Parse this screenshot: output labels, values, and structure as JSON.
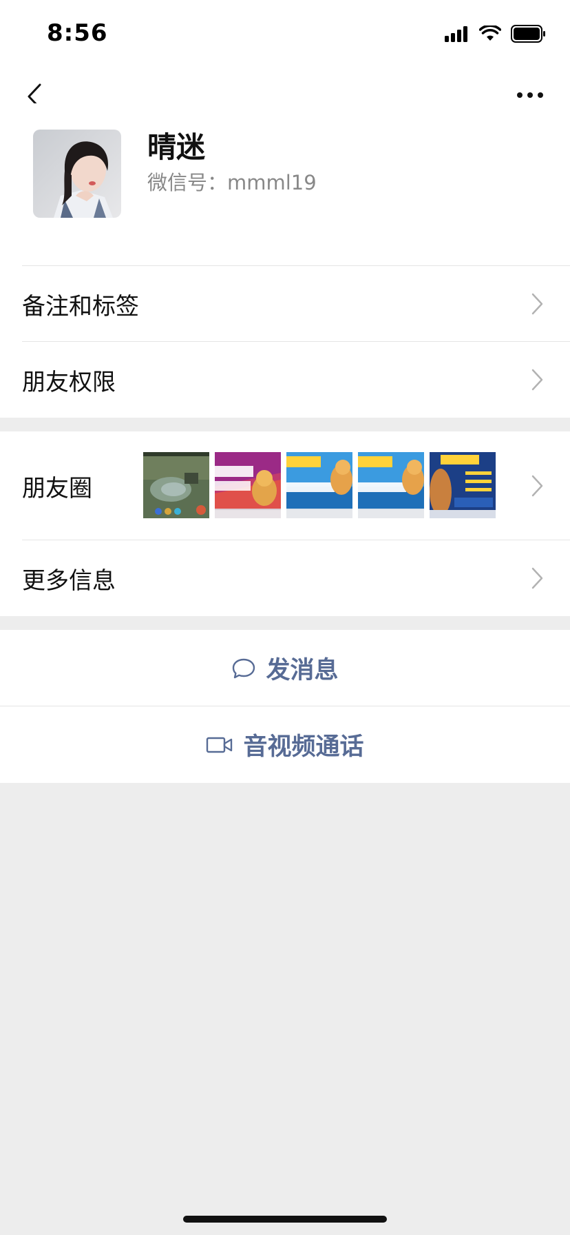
{
  "status_bar": {
    "time": "8:56"
  },
  "profile": {
    "nickname": "晴迷",
    "wechat_id": "微信号：mmml19"
  },
  "menu": {
    "notes_and_tags": "备注和标签",
    "friend_permissions": "朋友权限",
    "moments": "朋友圈",
    "more_info": "更多信息"
  },
  "moments_thumbnails": [
    {
      "name": "game-screenshot",
      "text": ""
    },
    {
      "name": "promo-victory",
      "text": "胜到手 这么优秀"
    },
    {
      "name": "promo-invincible-1",
      "text": "无敌 多么容易"
    },
    {
      "name": "promo-invincible-2",
      "text": "无敌 多么容易"
    },
    {
      "name": "promo-ranking",
      "text": "把把天秀"
    }
  ],
  "actions": {
    "send_message": "发消息",
    "av_call": "音视频通话"
  },
  "colors": {
    "link": "#576b95",
    "background": "#ededed",
    "card": "#ffffff",
    "divider": "#e5e5e5",
    "secondary_text": "#888888"
  },
  "icons": {
    "back": "chevron-left-icon",
    "more": "more-dots-icon",
    "chevron": "chevron-right-icon",
    "message": "chat-bubble-icon",
    "video": "video-camera-icon"
  }
}
